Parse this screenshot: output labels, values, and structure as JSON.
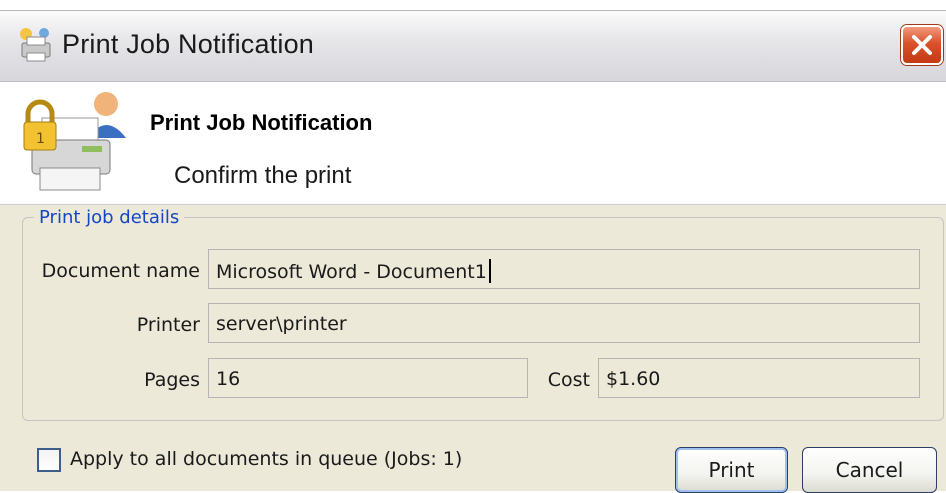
{
  "window": {
    "title": "Print Job Notification",
    "icon": "printer-notification-icon",
    "close_icon": "close-icon"
  },
  "header": {
    "title": "Print Job Notification",
    "subtitle": "Confirm the print",
    "icon": "printer-lock-user-icon"
  },
  "details": {
    "group_label": "Print job details",
    "document_name_label": "Document name",
    "document_name_value": "Microsoft Word - Document1",
    "printer_label": "Printer",
    "printer_value": "server\\printer",
    "pages_label": "Pages",
    "pages_value": "16",
    "cost_label": "Cost",
    "cost_value": "$1.60"
  },
  "footer": {
    "apply_all_label": "Apply to all documents in queue (Jobs: 1)",
    "apply_all_checked": false,
    "print_label": "Print",
    "cancel_label": "Cancel"
  },
  "colors": {
    "dialog_bg": "#ece9d8",
    "legend_text": "#1447c4",
    "close_button": "#d9522c"
  }
}
